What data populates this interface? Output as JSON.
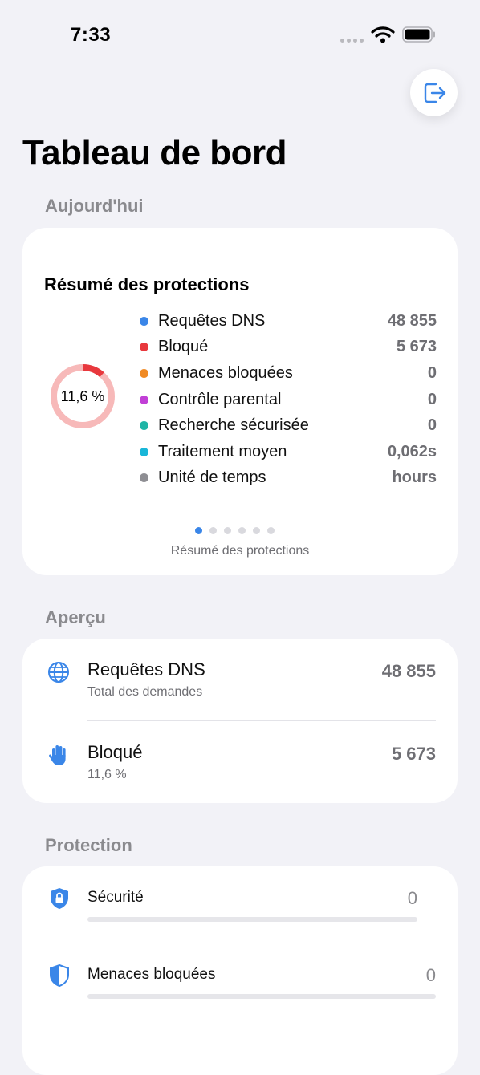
{
  "status_bar": {
    "time": "7:33"
  },
  "page": {
    "title": "Tableau de bord"
  },
  "sections": {
    "today": "Aujourd'hui",
    "overview": "Aperçu",
    "protection": "Protection"
  },
  "summary_card": {
    "title": "Résumé des protections",
    "donut_label": "11,6 %",
    "blocked_fraction": 0.116,
    "legend": [
      {
        "label": "Requêtes DNS",
        "value": "48 855",
        "color": "#3a86e8"
      },
      {
        "label": "Bloqué",
        "value": "5 673",
        "color": "#e8383d"
      },
      {
        "label": "Menaces bloquées",
        "value": "0",
        "color": "#f08a24"
      },
      {
        "label": "Contrôle parental",
        "value": "0",
        "color": "#c13fd6"
      },
      {
        "label": "Recherche sécurisée",
        "value": "0",
        "color": "#1fb5a6"
      },
      {
        "label": "Traitement moyen",
        "value": "0,062s",
        "color": "#19b6d8"
      },
      {
        "label": "Unité de temps",
        "value": "hours",
        "color": "#8e8e93"
      }
    ],
    "pager": {
      "count": 6,
      "active": 0
    },
    "caption": "Résumé des protections"
  },
  "overview": [
    {
      "icon": "globe-icon",
      "title": "Requêtes DNS",
      "subtitle": "Total des demandes",
      "value": "48 855"
    },
    {
      "icon": "hand-icon",
      "title": "Bloqué",
      "subtitle": "11,6 %",
      "value": "5 673"
    }
  ],
  "protection": [
    {
      "icon": "lock-shield-icon",
      "label": "Sécurité",
      "value": "0",
      "progress": 0
    },
    {
      "icon": "shield-icon",
      "label": "Menaces bloquées",
      "value": "0",
      "progress": 0
    }
  ],
  "colors": {
    "accent": "#3a86e8",
    "blocked": "#e8383d",
    "donut_track": "#f7b9b9"
  }
}
